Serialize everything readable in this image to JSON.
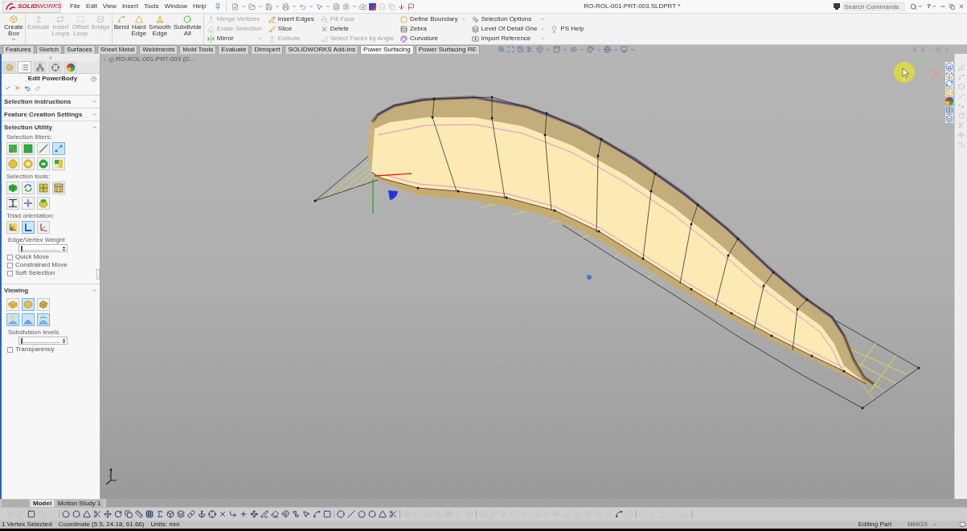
{
  "window": {
    "logo": "**SOLID**WORKS",
    "title": "RO-ROL-001-PRT-003.SLDPRT *",
    "search_placeholder": "Search Commands",
    "help": "?"
  },
  "menu": [
    "File",
    "Edit",
    "View",
    "Insert",
    "Tools",
    "Window",
    "Help"
  ],
  "ribbon": {
    "large_groups": [
      [
        {
          "label": "Create Box",
          "disabled": false,
          "dropdown": true
        }
      ],
      [
        {
          "label": "Extrude",
          "disabled": true,
          "dropdown": false
        },
        {
          "label": "Insert Loops",
          "disabled": true,
          "dropdown": false
        },
        {
          "label": "Offset Loop",
          "disabled": true,
          "dropdown": false
        },
        {
          "label": "Bridge",
          "disabled": true,
          "dropdown": false
        }
      ],
      [
        {
          "label": "Bend",
          "disabled": false,
          "dropdown": false
        },
        {
          "label": "Hard Edge",
          "disabled": false,
          "dropdown": false
        },
        {
          "label": "Smooth Edge",
          "disabled": false,
          "dropdown": false
        },
        {
          "label": "Subdivide All",
          "disabled": false,
          "dropdown": false
        }
      ]
    ],
    "columns": [
      [
        {
          "label": "Merge Vertices",
          "disabled": true,
          "dropdown": false
        },
        {
          "label": "Erase Selection",
          "disabled": true,
          "dropdown": false
        },
        {
          "label": "Mirror",
          "disabled": false,
          "dropdown": true
        }
      ],
      [
        {
          "label": "Insert Edges",
          "disabled": false,
          "dropdown": false
        },
        {
          "label": "Slice",
          "disabled": false,
          "dropdown": false
        },
        {
          "label": "Extrude",
          "disabled": true,
          "dropdown": false
        }
      ],
      [
        {
          "label": "Fill Face",
          "disabled": true,
          "dropdown": false
        },
        {
          "label": "Delete",
          "disabled": false,
          "dropdown": false
        },
        {
          "label": "Select Faces by Angle",
          "disabled": true,
          "dropdown": false
        }
      ],
      [
        {
          "label": "Define Boundary",
          "disabled": false,
          "dropdown": true
        },
        {
          "label": "Zebra",
          "disabled": false,
          "dropdown": false
        },
        {
          "label": "Curvature",
          "disabled": false,
          "dropdown": false
        }
      ],
      [
        {
          "label": "Selection Options",
          "disabled": false,
          "dropdown": true
        },
        {
          "label": "Level Of Detail One",
          "disabled": false,
          "dropdown": true
        },
        {
          "label": "Import Reference",
          "disabled": false,
          "dropdown": true
        }
      ],
      [
        {
          "label": "PS Help",
          "disabled": false,
          "dropdown": false
        }
      ]
    ]
  },
  "command_tabs": [
    {
      "label": "Features",
      "selected": false
    },
    {
      "label": "Sketch",
      "selected": false
    },
    {
      "label": "Surfaces",
      "selected": false
    },
    {
      "label": "Sheet Metal",
      "selected": false
    },
    {
      "label": "Weldments",
      "selected": false
    },
    {
      "label": "Mold Tools",
      "selected": false
    },
    {
      "label": "Evaluate",
      "selected": false
    },
    {
      "label": "Dimxpert",
      "selected": false
    },
    {
      "label": "SOLIDWORKS Add-Ins",
      "selected": false
    },
    {
      "label": "Power Surfacing",
      "selected": true
    },
    {
      "label": "Power Surfacing RE",
      "selected": false
    }
  ],
  "property_manager": {
    "tabs": [
      {
        "selected": false
      },
      {
        "selected": true
      },
      {
        "selected": false
      },
      {
        "selected": false
      },
      {
        "selected": false
      }
    ],
    "title": "Edit PowerBody",
    "sections": [
      {
        "title": "Selection Instructions",
        "expanded": false
      },
      {
        "title": "Feature Creation Settings",
        "expanded": false
      },
      {
        "title": "Selection Utility",
        "expanded": true,
        "items": [
          {
            "kind": "label",
            "text": "Selection filters:"
          },
          {
            "kind": "icons",
            "buttons": [
              {
                "selected": false
              },
              {
                "selected": false
              },
              {
                "selected": false
              },
              {
                "selected": true
              }
            ]
          },
          {
            "kind": "icons",
            "buttons": [
              {
                "selected": false
              },
              {
                "selected": false
              },
              {
                "selected": false
              },
              {
                "selected": false
              }
            ]
          },
          {
            "kind": "label",
            "text": "Selection tools:"
          },
          {
            "kind": "icons",
            "buttons": [
              {
                "selected": false
              },
              {
                "selected": false
              },
              {
                "selected": false
              },
              {
                "selected": false
              }
            ]
          },
          {
            "kind": "icons",
            "buttons": [
              {
                "selected": false
              },
              {
                "selected": false
              },
              {
                "selected": false
              }
            ]
          },
          {
            "kind": "label",
            "text": "Triad orientation:"
          },
          {
            "kind": "icons",
            "buttons": [
              {
                "selected": false
              },
              {
                "selected": true
              },
              {
                "selected": false
              }
            ]
          },
          {
            "kind": "slider",
            "label": "Edge/Vertex Weight",
            "level": 0
          },
          {
            "kind": "checkbox",
            "label": "Quick Move",
            "checked": false
          },
          {
            "kind": "checkbox",
            "label": "Constrained Move",
            "checked": false
          },
          {
            "kind": "checkbox",
            "label": "Soft Selection",
            "checked": false
          }
        ]
      },
      {
        "title": "Viewing",
        "expanded": true,
        "items": [
          {
            "kind": "icons",
            "buttons": [
              {
                "selected": false
              },
              {
                "selected": true
              },
              {
                "selected": false
              }
            ]
          },
          {
            "kind": "icons",
            "buttons": [
              {
                "selected": true
              },
              {
                "selected": true
              },
              {
                "selected": true
              }
            ]
          },
          {
            "kind": "slider",
            "label": "Subdivision levels",
            "level": 0
          },
          {
            "kind": "checkbox",
            "label": "Transparency",
            "checked": false
          }
        ]
      }
    ]
  },
  "viewport": {
    "tree_item": "RO-ROL-001-PRT-003 (D..."
  },
  "bottom_tabs": [
    {
      "label": "Model",
      "selected": true
    },
    {
      "label": "Motion Study 1",
      "selected": false
    }
  ],
  "bottom_toolbar": [
    [
      {
        "disabled": true
      },
      {
        "disabled": true
      },
      {
        "disabled": false
      },
      {
        "disabled": true
      },
      {
        "disabled": true
      }
    ],
    [
      {
        "disabled": false
      },
      {
        "disabled": false
      },
      {
        "disabled": false
      },
      {
        "disabled": false
      },
      {
        "disabled": false
      },
      {
        "disabled": false
      },
      {
        "disabled": false
      },
      {
        "disabled": false
      },
      {
        "disabled": false
      },
      {
        "disabled": false
      },
      {
        "disabled": false
      },
      {
        "disabled": false
      },
      {
        "disabled": false
      },
      {
        "disabled": false
      },
      {
        "disabled": false
      },
      {
        "disabled": false
      },
      {
        "disabled": false
      },
      {
        "disabled": false
      },
      {
        "disabled": false
      },
      {
        "disabled": false
      },
      {
        "disabled": false
      },
      {
        "disabled": false
      },
      {
        "disabled": false
      },
      {
        "disabled": false
      },
      {
        "disabled": false
      },
      {
        "disabled": false
      }
    ],
    [
      {
        "disabled": false
      },
      {
        "disabled": false
      },
      {
        "disabled": false
      },
      {
        "disabled": false
      },
      {
        "disabled": false
      },
      {
        "disabled": false
      }
    ],
    [
      {
        "disabled": true
      },
      {
        "disabled": true
      },
      {
        "disabled": true
      },
      {
        "disabled": true
      },
      {
        "disabled": true
      },
      {
        "disabled": true
      },
      {
        "disabled": true
      }
    ],
    [
      {
        "disabled": true
      },
      {
        "disabled": true
      },
      {
        "disabled": true
      },
      {
        "disabled": true
      },
      {
        "disabled": true
      },
      {
        "disabled": true
      },
      {
        "disabled": true
      },
      {
        "disabled": true
      },
      {
        "disabled": true
      },
      {
        "disabled": true
      },
      {
        "disabled": true
      },
      {
        "disabled": true
      },
      {
        "disabled": true
      },
      {
        "disabled": false
      },
      {
        "disabled": true
      }
    ],
    [
      {
        "disabled": true
      },
      {
        "disabled": true
      },
      {
        "disabled": true
      },
      {
        "disabled": true
      },
      {
        "disabled": true
      }
    ]
  ],
  "status_bar": {
    "left": [
      "1 Vertex Selected",
      "Coordinate (5.5, 24.18, 61.66)",
      "Units: mm"
    ],
    "mode": "Editing Part",
    "units": "MMGS"
  }
}
